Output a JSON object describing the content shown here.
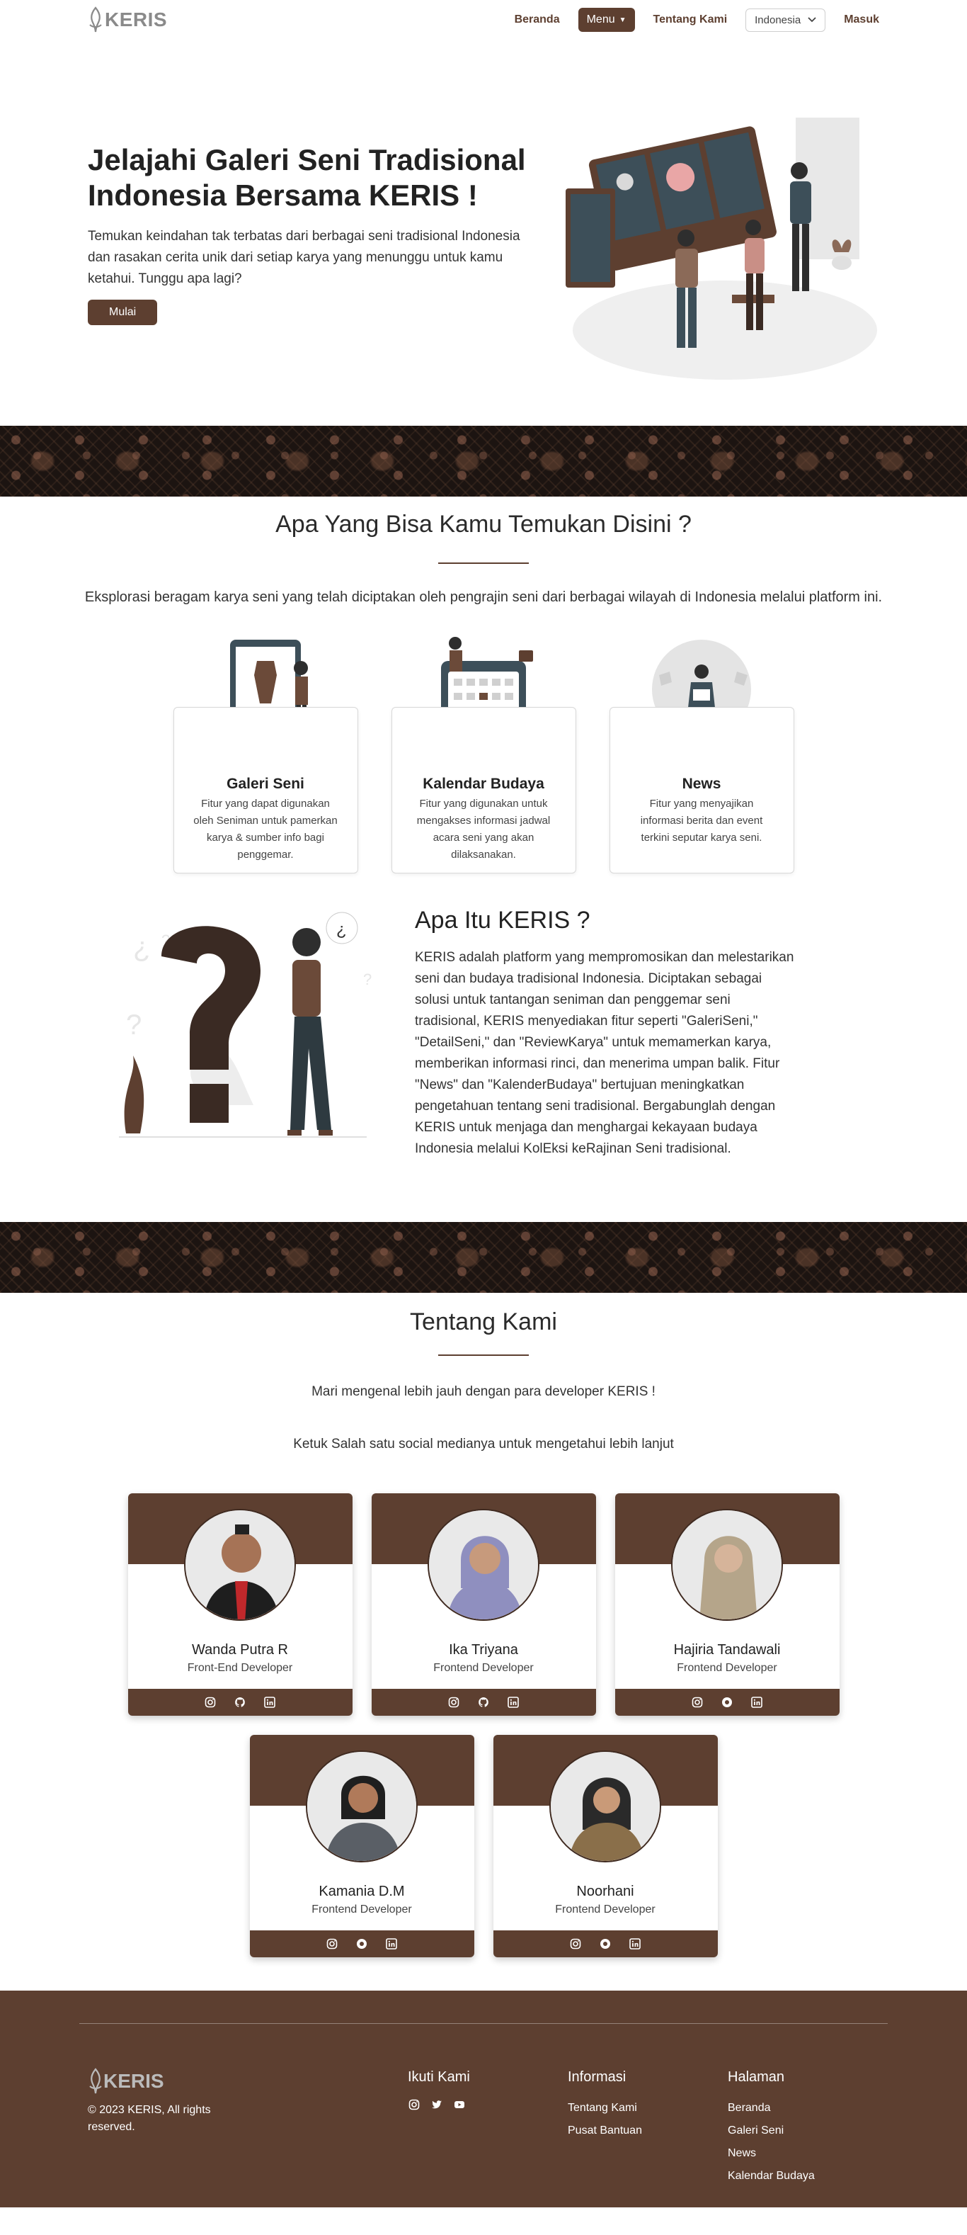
{
  "brand": {
    "name": "KERIS"
  },
  "nav": {
    "home": "Beranda",
    "menu": "Menu",
    "about": "Tentang Kami",
    "language": "Indonesia",
    "login": "Masuk"
  },
  "hero": {
    "title": "Jelajahi Galeri Seni Tradisional Indonesia Bersama KERIS !",
    "description": "Temukan keindahan tak terbatas dari berbagai seni tradisional Indonesia dan rasakan cerita unik dari setiap karya yang menunggu untuk kamu ketahui. Tunggu apa lagi?",
    "cta": "Mulai"
  },
  "features": {
    "title": "Apa Yang Bisa Kamu Temukan Disini ?",
    "description": "Eksplorasi beragam karya seni yang telah diciptakan oleh pengrajin seni dari berbagai wilayah di Indonesia melalui platform ini.",
    "cards": [
      {
        "title": "Galeri Seni",
        "description": "Fitur yang dapat digunakan oleh Seniman untuk pamerkan karya & sumber info bagi penggemar."
      },
      {
        "title": "Kalendar Budaya",
        "description": "Fitur yang digunakan untuk mengakses informasi jadwal acara seni yang akan dilaksanakan."
      },
      {
        "title": "News",
        "description": "Fitur yang menyajikan informasi berita dan event terkini seputar karya seni."
      }
    ]
  },
  "about": {
    "title": "Apa Itu KERIS ?",
    "body": "KERIS adalah platform yang mempromosikan dan melestarikan seni dan budaya tradisional Indonesia. Diciptakan sebagai solusi untuk tantangan seniman dan penggemar seni tradisional, KERIS menyediakan fitur seperti \"GaleriSeni,\" \"DetailSeni,\" dan \"ReviewKarya\" untuk memamerkan karya, memberikan informasi rinci, dan menerima umpan balik. Fitur \"News\" dan \"KalenderBudaya\" bertujuan meningkatkan pengetahuan tentang seni tradisional. Bergabunglah dengan KERIS untuk menjaga dan menghargai kekayaan budaya Indonesia melalui KolEksi keRajinan Seni tradisional."
  },
  "team": {
    "title": "Tentang Kami",
    "subtitle": "Mari mengenal lebih jauh dengan para developer KERIS !",
    "subtitle2": "Ketuk Salah satu social medianya untuk mengetahui lebih lanjut",
    "members": [
      {
        "name": "Wanda Putra R",
        "role": "Front-End Developer"
      },
      {
        "name": "Ika Triyana",
        "role": "Frontend Developer"
      },
      {
        "name": "Hajiria Tandawali",
        "role": "Frontend Developer"
      },
      {
        "name": "Kamania D.M",
        "role": "Frontend Developer"
      },
      {
        "name": "Noorhani",
        "role": "Frontend Developer"
      }
    ]
  },
  "footer": {
    "copyright": "© 2023 KERIS, All rights reserved.",
    "follow_title": "Ikuti Kami",
    "info_title": "Informasi",
    "info_links": [
      "Tentang Kami",
      "Pusat Bantuan"
    ],
    "pages_title": "Halaman",
    "pages_links": [
      "Beranda",
      "Galeri Seni",
      "News",
      "Kalendar Budaya"
    ]
  },
  "colors": {
    "brand_brown": "#5d3f30",
    "batik_dark": "#1c1411"
  }
}
